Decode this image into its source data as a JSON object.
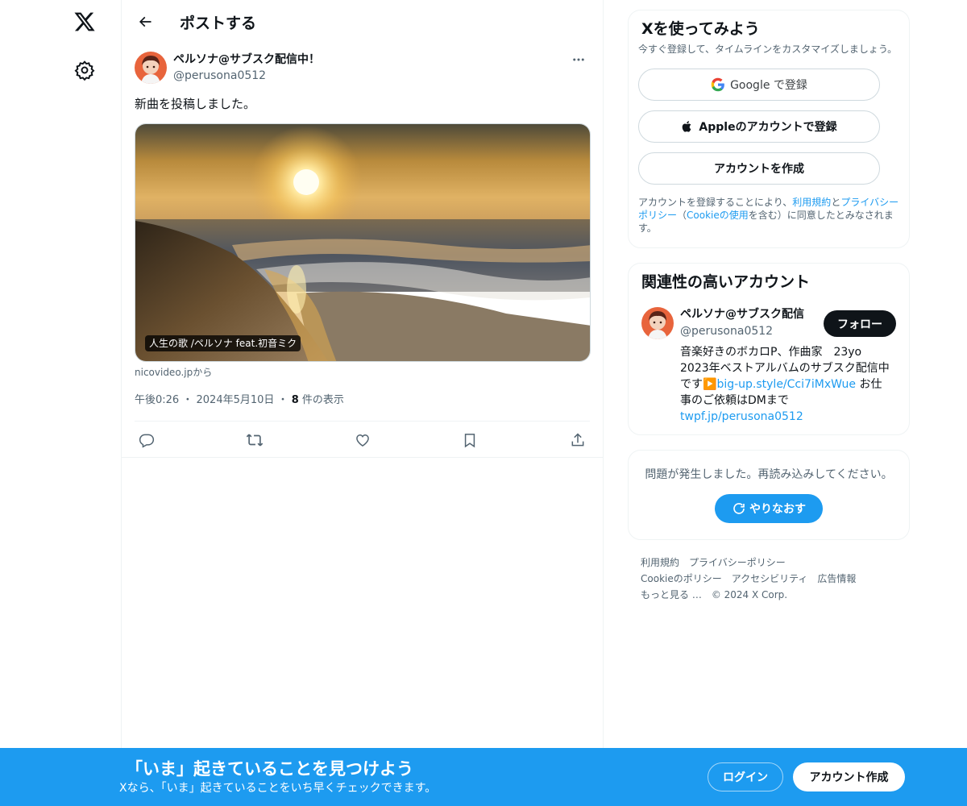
{
  "nav": {
    "logo_icon": "x-logo-icon",
    "settings_icon": "gear-icon"
  },
  "header": {
    "title": "ポストする",
    "back_icon": "back-arrow-icon"
  },
  "post": {
    "author_name": "ペルソナ@サブスク配信中！",
    "author_handle": "@perusona0512",
    "text": "新曲を投稿しました。",
    "media_caption": "人生の歌 /ペルソナ feat.初音ミク",
    "media_source": "nicovideo.jpから",
    "time": "午後0:26",
    "separator": "・",
    "date": "2024年5月10日",
    "view_count": "8",
    "view_label": " 件の表示",
    "actions": [
      "reply-icon",
      "repost-icon",
      "like-icon",
      "bookmark-icon",
      "share-icon"
    ]
  },
  "signup": {
    "title": "Xを使ってみよう",
    "subtitle": "今すぐ登録して、タイムラインをカスタマイズしましょう。",
    "google_label": "Google で登録",
    "apple_label": "Appleのアカウントで登録",
    "create_label": "アカウントを作成",
    "legal_pre": "アカウントを登録することにより、",
    "legal_terms": "利用規約",
    "legal_and": "と",
    "legal_privacy": "プライバシーポリシー",
    "legal_mid": "（",
    "legal_cookie": "Cookieの使用",
    "legal_post": "を含む）に同意したとみなされます。"
  },
  "related": {
    "title": "関連性の高いアカウント",
    "name": "ペルソナ@サブスク配信",
    "handle": "@perusona0512",
    "follow_label": "フォロー",
    "bio_1": "音楽好きのボカロP、作曲家　23yo 2023年ベストアルバムのサブスク配信中です",
    "bio_emoji": "▶️",
    "bio_link1": "big-up.style/Cci7iMxWue",
    "bio_2": " お仕事のご依頼はDMまで ",
    "bio_link2": "twpf.jp/perusona0512"
  },
  "error": {
    "text": "問題が発生しました。再読み込みしてください。",
    "retry_label": "やりなおす"
  },
  "footer": {
    "links": [
      "利用規約",
      "プライバシーポリシー",
      "Cookieのポリシー",
      "アクセシビリティ",
      "広告情報",
      "もっと見る …",
      "© 2024 X Corp."
    ]
  },
  "bottom": {
    "title": "「いま」起きていることを見つけよう",
    "subtitle": "Xなら、「いま」起きていることをいち早くチェックできます。",
    "login_label": "ログイン",
    "signup_label": "アカウント作成"
  },
  "colors": {
    "accent": "#1d9bf0",
    "text": "#0f1419",
    "secondary": "#536471",
    "border": "#eff3f4"
  }
}
